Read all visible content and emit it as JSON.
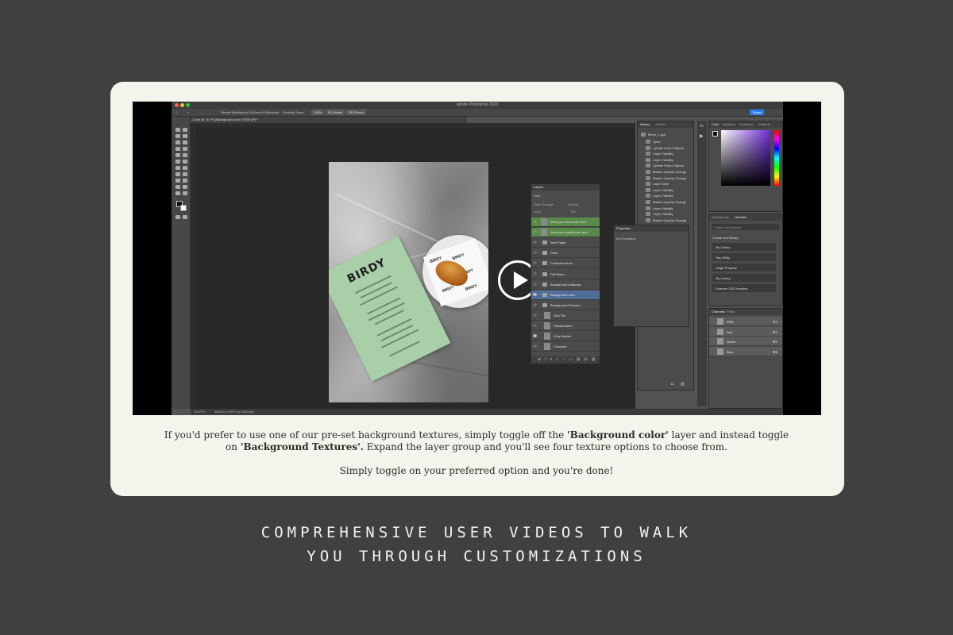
{
  "app": {
    "window_title": "Adobe Photoshop 2023",
    "document_tab": "Menu_1.psd @ 16.7% (Background color, RGB/16*) *",
    "share_label": "Share",
    "options": {
      "resize_windows": "Resize Windows to Fit",
      "zoom_all": "Zoom All Windows",
      "scrubby_zoom": "Scrubby Zoom",
      "zoom_level": "100%",
      "fit_screen": "Fit Screen",
      "fill_screen": "Fill Screen"
    },
    "status": {
      "zoom": "16.67%",
      "dimensions": "3840 px x 5470 px (300 ppi)"
    }
  },
  "document": {
    "menu_brand": "BIRDY",
    "napkin_mark": "BIRDY"
  },
  "panels": {
    "history": {
      "tab_history": "History",
      "tab_actions": "Actions",
      "snapshot": "Menu_1.psd",
      "items": [
        "Open",
        "Update Smart Objects",
        "Layer Visibility",
        "Layer Visibility",
        "Update Smart Objects",
        "Master Opacity Change",
        "Master Opacity Change",
        "Layer Style",
        "Layer Visibility",
        "Layer Visibility",
        "Master Opacity Change",
        "Layer Visibility",
        "Layer Visibility",
        "Master Opacity Change"
      ]
    },
    "layers": {
      "title": "Layers",
      "filter": "Kind",
      "blend_mode": "Pass Through",
      "opacity_label": "Opacity:",
      "lock_label": "Lock:",
      "fill_label": "Fill:",
      "rows": [
        {
          "name": "Insert your menu art here",
          "kind": "smart"
        },
        {
          "name": "Insert your napkin art here",
          "kind": "smart"
        },
        {
          "name": "Wax Paper",
          "kind": "folder"
        },
        {
          "name": "Plate",
          "kind": "folder"
        },
        {
          "name": "Croissant Items",
          "kind": "folder"
        },
        {
          "name": "Flat Menu",
          "kind": "folder"
        },
        {
          "name": "Background shadows",
          "kind": "folder"
        },
        {
          "name": "Background color",
          "kind": "folder"
        },
        {
          "name": "Background Textures",
          "kind": "folder"
        },
        {
          "name": "Grid Tile",
          "kind": "layer"
        },
        {
          "name": "Plasterboard",
          "kind": "layer"
        },
        {
          "name": "Grey Marble",
          "kind": "layer"
        },
        {
          "name": "Concrete",
          "kind": "layer"
        }
      ]
    },
    "properties": {
      "title": "Properties",
      "body": "No Properties"
    },
    "color": {
      "tab_color": "Color",
      "tab_swatches": "Swatches",
      "tab_gradients": "Gradients",
      "tab_patterns": "Patterns"
    },
    "libraries": {
      "tab_adjustments": "Adjustments",
      "tab_libraries": "Libraries",
      "search": "Search all libraries",
      "create_new": "Create new library",
      "items": [
        "My Library",
        "Ray Wilby",
        "Origin Property",
        "My Library",
        "Summer 2022 brushes"
      ]
    },
    "channels": {
      "tab_channels": "Channels",
      "tab_paths": "Paths",
      "rows": [
        {
          "name": "RGB",
          "shortcut": "⌘2"
        },
        {
          "name": "Red",
          "shortcut": "⌘3"
        },
        {
          "name": "Green",
          "shortcut": "⌘4"
        },
        {
          "name": "Blue",
          "shortcut": "⌘5"
        }
      ]
    }
  },
  "caption": {
    "line1_pre": "If you'd prefer to use one of our pre-set background textures, simply toggle off the ",
    "line1_bold": "'Background color'",
    "line1_post": " layer and instead toggle",
    "line2_pre": "on ",
    "line2_bold": "'Background Textures'.",
    "line2_post": " Expand the layer group and you'll see four texture options to choose from.",
    "line3": "Simply toggle on your preferred option and you're done!"
  },
  "tagline": {
    "line1": "COMPREHENSIVE USER VIDEOS TO WALK",
    "line2": "YOU THROUGH CUSTOMIZATIONS"
  },
  "colors": {
    "background": "#404040",
    "card": "#f4f4ec",
    "layer_active": "#5a8a4a",
    "layer_selected": "#4f6f9a",
    "accent_blue": "#2d7ff9"
  }
}
